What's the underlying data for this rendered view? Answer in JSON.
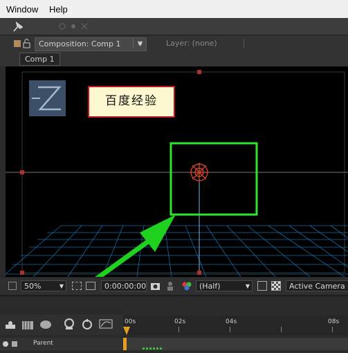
{
  "menu": [
    "Window",
    "Help"
  ],
  "panel": {
    "composition_tab": "Composition: Comp 1",
    "layer_tab": "Layer: (none)",
    "comp_button": "Comp 1"
  },
  "viewer": {
    "text_layer": "百度经验"
  },
  "viewer_bar": {
    "zoom": "50%",
    "timecode": "0:00:00:00",
    "resolution": "(Half)",
    "camera": "Active Camera"
  },
  "timeline": {
    "ruler_labels": [
      "00s",
      "02s",
      "04s",
      "08s"
    ],
    "column_parent": "Parent"
  },
  "colors": {
    "highlight_box": "#2ee62e",
    "arrow": "#1fd21f",
    "grid": "#1f7fbf",
    "text_box_border": "#c0141c"
  }
}
